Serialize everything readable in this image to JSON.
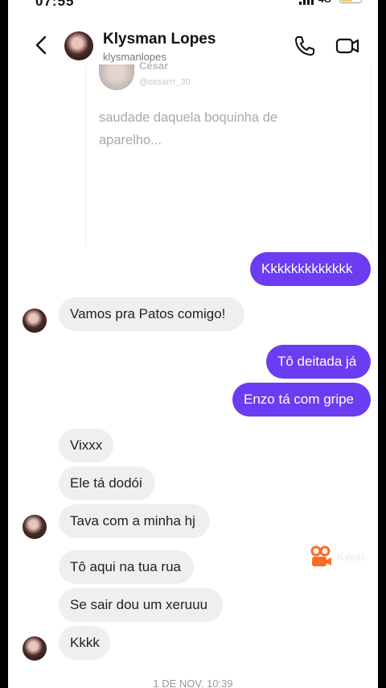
{
  "status_bar": {
    "time": "07:55",
    "network": "4G"
  },
  "header": {
    "name": "Klysman Lopes",
    "username": "klysmanlopes"
  },
  "shared_post": {
    "author": "César",
    "handle": "@cesarrr_30",
    "text": "saudade daquela boquinha de aparelho..."
  },
  "messages": [
    {
      "side": "out",
      "text": "Kkkkkkkkkkkkk"
    },
    {
      "side": "in",
      "text": "Vamos pra Patos comigo!"
    },
    {
      "side": "out",
      "text": "Tô deitada já"
    },
    {
      "side": "out",
      "text": "Enzo tá com gripe"
    },
    {
      "side": "in",
      "text": "Vixxx"
    },
    {
      "side": "in",
      "text": "Ele tá dodói"
    },
    {
      "side": "in",
      "text": "Tava com a minha hj"
    },
    {
      "side": "in",
      "text": "Tô aqui na tua rua"
    },
    {
      "side": "in",
      "text": "Se sair dou um xeruuu"
    },
    {
      "side": "in",
      "text": "Kkkk"
    }
  ],
  "watermark": {
    "text": "Kwai"
  },
  "timestamp": "1 DE NOV. 10:39",
  "colors": {
    "outgoing_bubble": "#6b3cf2",
    "incoming_bubble": "#efefef",
    "watermark_accent": "#ff6a1f"
  }
}
